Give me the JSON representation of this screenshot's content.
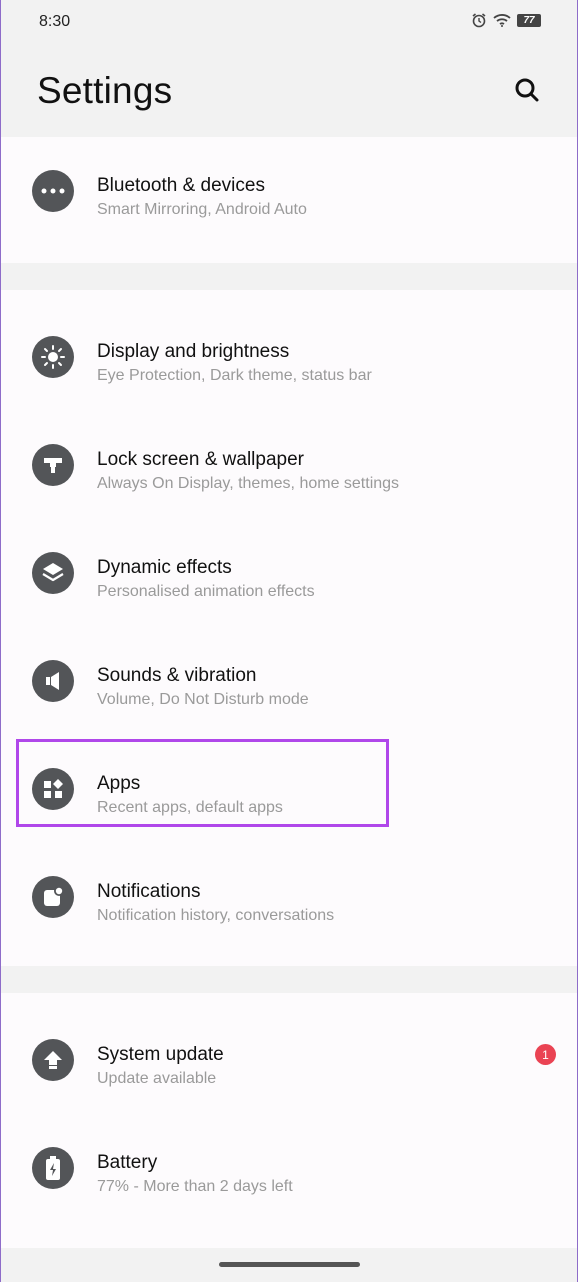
{
  "status_bar": {
    "time": "8:30",
    "battery": "77"
  },
  "header": {
    "title": "Settings"
  },
  "groups": [
    {
      "items": [
        {
          "title": "Bluetooth & devices",
          "subtitle": "Smart Mirroring, Android Auto"
        }
      ]
    },
    {
      "items": [
        {
          "title": "Display and brightness",
          "subtitle": "Eye Protection, Dark theme, status bar"
        },
        {
          "title": "Lock screen & wallpaper",
          "subtitle": "Always On Display, themes, home settings"
        },
        {
          "title": "Dynamic effects",
          "subtitle": "Personalised animation effects"
        },
        {
          "title": "Sounds & vibration",
          "subtitle": "Volume, Do Not Disturb mode"
        },
        {
          "title": "Apps",
          "subtitle": "Recent apps, default apps"
        },
        {
          "title": "Notifications",
          "subtitle": "Notification history, conversations"
        }
      ]
    },
    {
      "items": [
        {
          "title": "System update",
          "subtitle": "Update available",
          "badge": "1"
        },
        {
          "title": "Battery",
          "subtitle": "77% - More than 2 days left"
        }
      ]
    }
  ],
  "colors": {
    "highlight": "#b047ea",
    "badge": "#ea4353",
    "icon_bg": "#535558"
  },
  "icons": [
    "more-icon",
    "brightness-icon",
    "lock-screen-icon",
    "layers-icon",
    "speaker-icon",
    "apps-grid-icon",
    "notification-icon",
    "upload-icon",
    "battery-charging-icon"
  ]
}
